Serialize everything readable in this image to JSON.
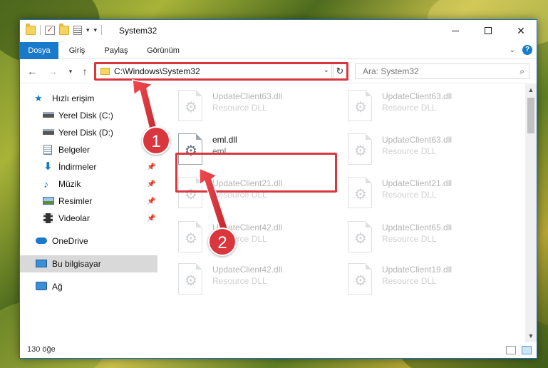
{
  "window": {
    "title": "System32"
  },
  "ribbon": {
    "tabs": [
      "Dosya",
      "Giriş",
      "Paylaş",
      "Görünüm"
    ]
  },
  "address": {
    "path": "C:\\Windows\\System32"
  },
  "search": {
    "placeholder": "Ara: System32"
  },
  "sidebar": {
    "items": [
      {
        "label": "Hızlı erişim",
        "icon": "star-icon"
      },
      {
        "label": "Yerel Disk (C:)",
        "icon": "drive-icon"
      },
      {
        "label": "Yerel Disk (D:)",
        "icon": "drive-icon"
      },
      {
        "label": "Belgeler",
        "icon": "documents-icon"
      },
      {
        "label": "İndirmeler",
        "icon": "download-icon"
      },
      {
        "label": "Müzik",
        "icon": "music-icon"
      },
      {
        "label": "Resimler",
        "icon": "pictures-icon"
      },
      {
        "label": "Videolar",
        "icon": "videos-icon"
      },
      {
        "label": "OneDrive",
        "icon": "cloud-icon"
      },
      {
        "label": "Bu bilgisayar",
        "icon": "computer-icon"
      },
      {
        "label": "Ağ",
        "icon": "network-icon"
      }
    ]
  },
  "files": [
    {
      "name": "UpdateClient63.dll",
      "desc": "Resource DLL"
    },
    {
      "name": "UpdateClient63.dll",
      "desc": "Resource DLL"
    },
    {
      "name": "eml.dll",
      "desc": "eml"
    },
    {
      "name": "UpdateClient63.dll",
      "desc": "Resource DLL"
    },
    {
      "name": "UpdateClient21.dll",
      "desc": "Resource DLL"
    },
    {
      "name": "UpdateClient21.dll",
      "desc": "Resource DLL"
    },
    {
      "name": "UpdateClient42.dll",
      "desc": "Resource DLL"
    },
    {
      "name": "UpdateClient65.dll",
      "desc": "Resource DLL"
    },
    {
      "name": "UpdateClient42.dll",
      "desc": "Resource DLL"
    },
    {
      "name": "UpdateClient19.dll",
      "desc": "Resource DLL"
    }
  ],
  "status": {
    "count": "130 öğe"
  },
  "callouts": {
    "step1": "1",
    "step2": "2"
  },
  "colors": {
    "accent": "#1979ca",
    "highlight": "#d9363e"
  }
}
